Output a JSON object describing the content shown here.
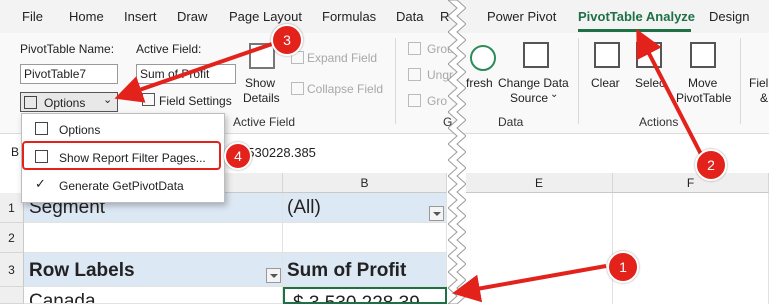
{
  "tabs": [
    "File",
    "Home",
    "Insert",
    "Draw",
    "Page Layout",
    "Formulas",
    "Data",
    "R",
    "Power Pivot",
    "PivotTable Analyze",
    "Design"
  ],
  "ribbon": {
    "pivot_name_label": "PivotTable Name:",
    "pivot_name_value": "PivotTable7",
    "options_label": "Options",
    "active_field_label": "Active Field:",
    "active_field_value": "Sum of Profit",
    "field_settings_label": "Field Settings",
    "show_details_line1": "Show",
    "show_details_line2": "Details",
    "expand_field": "Expand Field",
    "collapse_field": "Collapse Field",
    "active_field_group": "Active Field",
    "group_sel": "Grou",
    "ungroup": "Ungr",
    "group_field": "Gro",
    "group_g": "G",
    "refresh": "fresh",
    "change_data_line1": "Change Data",
    "change_data_line2": "Source",
    "data_group": "Data",
    "clear": "Clear",
    "select": "Selec",
    "move_line1": "Move",
    "move_line2": "PivotTable",
    "actions_group": "Actions",
    "fields_trunc": "Fiel",
    "fields_trunc2": "&"
  },
  "menu": {
    "items": [
      "Options",
      "Show Report Filter Pages...",
      "Generate GetPivotData"
    ]
  },
  "formula_bar": {
    "name_box": "B",
    "value": "3530228.385"
  },
  "grid": {
    "columns": [
      "B",
      "E",
      "F"
    ],
    "rows": [
      "1",
      "2",
      "3"
    ],
    "a1": "Segment",
    "b1": "(All)",
    "a3": "Row Labels",
    "b3": "Sum of Profit",
    "a4": "Canada",
    "b4": "$ 3,530,228.39"
  },
  "badges": [
    "1",
    "2",
    "3",
    "4"
  ],
  "colors": {
    "accent": "#1e7145",
    "annotation": "#e3221c",
    "pivot_header": "#dde8f5"
  },
  "icons": [
    "options-icon",
    "field-settings-icon",
    "show-details-icon",
    "expand-icon",
    "collapse-icon",
    "group-icon",
    "refresh-icon",
    "change-data-source-icon",
    "clear-icon",
    "select-icon",
    "move-pivottable-icon",
    "checkmark-icon",
    "chevron-down-icon",
    "filter-dropdown-icon"
  ]
}
